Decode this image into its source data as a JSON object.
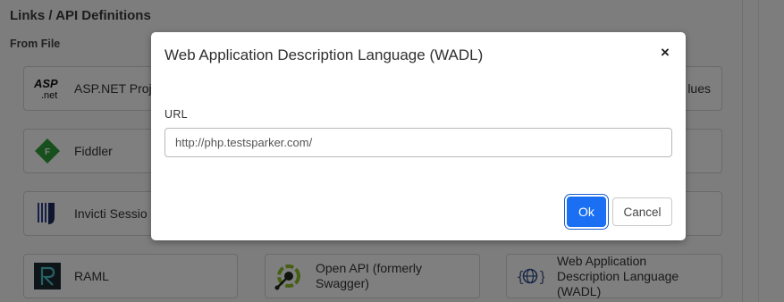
{
  "page": {
    "section_title": "Links / API Definitions",
    "sub_title": "From File",
    "cards": [
      {
        "label": "ASP.NET Proj",
        "icon": "aspnet-icon"
      },
      {
        "label": "lues",
        "icon": ""
      },
      {
        "label": "Fiddler",
        "icon": "fiddler-icon"
      },
      {
        "label": "Invicti Sessio",
        "icon": "invicti-icon"
      },
      {
        "label": "RAML",
        "icon": "raml-icon"
      },
      {
        "label": "Open API (formerly Swagger)",
        "icon": "openapi-icon"
      },
      {
        "label": "Web Application Description Language (WADL)",
        "icon": "wadl-icon"
      }
    ],
    "aspnet_logo_text": "ASP.net",
    "fiddler_logo_letter": "F"
  },
  "modal": {
    "title": "Web Application Description Language (WADL)",
    "close_symbol": "×",
    "url_label": "URL",
    "url_value": "http://php.testsparker.com/",
    "ok_label": "Ok",
    "cancel_label": "Cancel",
    "primary_color": "#1a6ff2"
  }
}
